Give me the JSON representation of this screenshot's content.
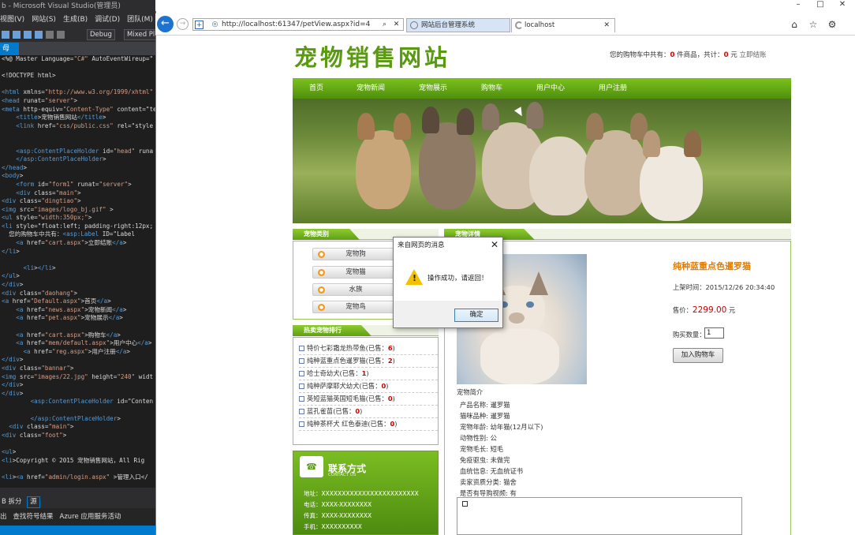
{
  "vs": {
    "title": "b - Microsoft Visual Studio(管理员)",
    "menu": [
      "视图(V)",
      "网站(S)",
      "生成(B)",
      "调试(D)",
      "团队(M)"
    ],
    "config": "Debug",
    "platform": "Mixed Pl",
    "tab": "母",
    "code_lines": [
      "<%@ Master Language=\"C#\" AutoEventWireup=\"",
      "",
      "<!DOCTYPE html>",
      "",
      "<html xmlns=\"http://www.w3.org/1999/xhtml\"",
      "<head runat=\"server\">",
      "<meta http-equiv=\"Content-Type\" content=\"te",
      "    <title>宠物销售网站</title>",
      "    <link href=\"css/public.css\" rel=\"style",
      "",
      "",
      "    <asp:ContentPlaceHolder id=\"head\" runa",
      "    </asp:ContentPlaceHolder>",
      "</head>",
      "<body>",
      "    <form id=\"form1\" runat=\"server\">",
      "    <div class=\"main\">",
      "<div class=\"dingtiao\">",
      "<img src=\"images/logo_bj.gif\" >",
      "<ul style=\"width:350px;\">",
      "<li style=\"float:left; padding-right:12px;",
      "  您的购物车中共有：<asp:Label ID=\"Label",
      "    <a href=\"cart.aspx\">立即结账</a>",
      "</li>",
      "",
      "      <li></li>",
      "</ul>",
      "</div>",
      "<div class=\"daohang\">",
      "<a href=\"Default.aspx\">首页</a>",
      "    <a href=\"news.aspx\">宠物新闻</a>",
      "    <a href=\"pet.aspx\">宠物展示</a>",
      "",
      "    <a href=\"cart.aspx\">购物车</a>",
      "    <a href=\"mem/default.aspx\">用户中心</a>",
      "      <a href=\"reg.aspx\">用户注册</a>",
      "</div>",
      "<div class=\"bannar\">",
      "<img src=\"images/22.jpg\" height=\"240\" widt",
      "</div>",
      "</div>",
      "        <asp:ContentPlaceHolder id=\"Conten",
      "",
      "        </asp:ContentPlaceHolder>",
      "  <div class=\"main\">",
      "<div class=\"foot\">",
      "",
      "<ul>",
      "<li>Copyright © 2015 宠物销售网站，All Rig",
      "",
      "<li><a href=\"admin/login.aspx\" >管理入口</",
      ""
    ],
    "view_tabs": [
      "B 拆分",
      "源"
    ],
    "output_tabs": [
      "出",
      "查找符号结果",
      "Azure 应用服务活动"
    ]
  },
  "browser": {
    "url": "http://localhost:61347/petView.aspx?id=4",
    "tabs": [
      {
        "label": "网站后台管理系统"
      },
      {
        "label": "localhost"
      }
    ]
  },
  "site": {
    "logo": "宠物销售网站",
    "cart_prefix": "您的购物车中共有：",
    "cart_items": "0",
    "cart_mid": " 件商品，共计：",
    "cart_total": "0",
    "cart_unit": " 元 ",
    "checkout": "立即结账",
    "nav": [
      "首页",
      "宠物新闻",
      "宠物展示",
      "购物车",
      "用户中心",
      "用户注册"
    ],
    "category_title": "宠物类别",
    "categories": [
      "宠物狗",
      "宠物猫",
      "水族",
      "宠物鸟"
    ],
    "hot_title": "热卖宠物排行",
    "hot": [
      {
        "name": "特价七彩霜龙热带鱼(已售：",
        "count": "6",
        "end": ")"
      },
      {
        "name": "纯种蓝重点色暹罗猫(已售：",
        "count": "2",
        "end": ")"
      },
      {
        "name": "哈士奇幼犬(已售：",
        "count": "1",
        "end": ")"
      },
      {
        "name": "纯种萨摩耶犬幼犬(已售：",
        "count": "0",
        "end": ")"
      },
      {
        "name": "英短蓝猫英国短毛猫(已售：",
        "count": "0",
        "end": ")"
      },
      {
        "name": "蓝孔雀苗(已售：",
        "count": "0",
        "end": ")"
      },
      {
        "name": "纯种茶杯犬 红色泰迪(已售：",
        "count": "0",
        "end": ")"
      }
    ],
    "contact": {
      "title": "联系方式",
      "subtitle": "CONTACT US",
      "address": "地址：XXXXXXXXXXXXXXXXXXXXXXXX",
      "phone": "电话：XXXX-XXXXXXXX",
      "fax": "传真：XXXX-XXXXXXXX",
      "mobile": "手机：XXXXXXXXXX"
    },
    "detail_title": "宠物详情",
    "product": {
      "name": "纯种蓝重点色暹罗猫",
      "time_label": "上架时间：",
      "time": "2015/12/26 20:34:40",
      "price_label": "售价：",
      "price": "2299.00",
      "price_unit": "元",
      "qty_label": "购买数量：",
      "qty": "1",
      "add_btn": "加入购物车",
      "intro_label": "宠物简介",
      "details": [
        "产品名称: 暹罗猫",
        "猫咪品种: 暹罗猫",
        "宠物年龄: 幼年猫(12月以下)",
        "动物性别: 公",
        "宠物毛长: 短毛",
        "免疫驱虫: 未做完",
        "血统信息: 无血统证书",
        "卖家资质分类: 猫舍",
        "是否有导购视频: 有"
      ]
    }
  },
  "dialog": {
    "title": "来自网页的消息",
    "message": "操作成功，请返回！",
    "ok": "确定"
  }
}
